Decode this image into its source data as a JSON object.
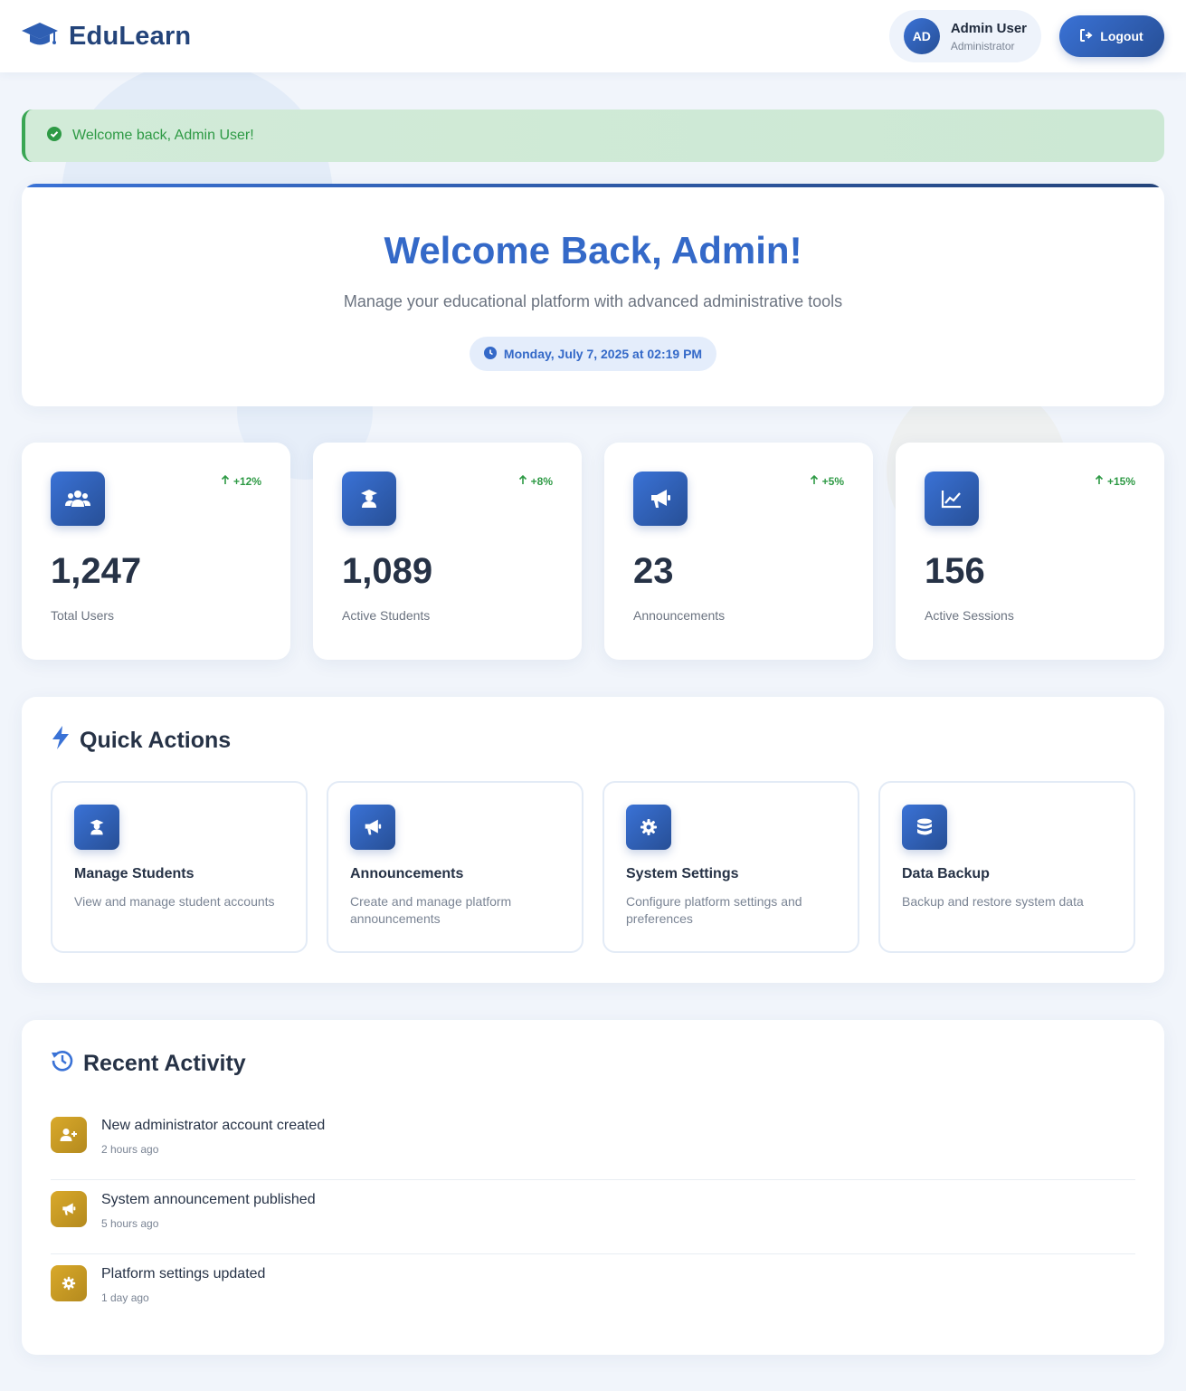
{
  "header": {
    "brand": "EduLearn",
    "user_initials": "AD",
    "user_name": "Admin User",
    "user_role": "Administrator",
    "logout_label": "Logout"
  },
  "alert": {
    "message": "Welcome back, Admin User!"
  },
  "hero": {
    "title": "Welcome Back, Admin!",
    "subtitle": "Manage your educational platform with advanced administrative tools",
    "datetime": "Monday, July 7, 2025 at 02:19 PM"
  },
  "stats": [
    {
      "icon": "users-icon",
      "trend": "+12%",
      "value": "1,247",
      "label": "Total Users"
    },
    {
      "icon": "graduate-icon",
      "trend": "+8%",
      "value": "1,089",
      "label": "Active Students"
    },
    {
      "icon": "megaphone-icon",
      "trend": "+5%",
      "value": "23",
      "label": "Announcements"
    },
    {
      "icon": "chart-line-icon",
      "trend": "+15%",
      "value": "156",
      "label": "Active Sessions"
    }
  ],
  "quick_actions": {
    "title": "Quick Actions",
    "items": [
      {
        "icon": "graduate-icon",
        "title": "Manage Students",
        "desc": "View and manage student accounts"
      },
      {
        "icon": "megaphone-icon",
        "title": "Announcements",
        "desc": "Create and manage platform announcements"
      },
      {
        "icon": "gear-icon",
        "title": "System Settings",
        "desc": "Configure platform settings and preferences"
      },
      {
        "icon": "database-icon",
        "title": "Data Backup",
        "desc": "Backup and restore system data"
      }
    ]
  },
  "recent_activity": {
    "title": "Recent Activity",
    "items": [
      {
        "icon": "user-plus-icon",
        "title": "New administrator account created",
        "time": "2 hours ago"
      },
      {
        "icon": "megaphone-icon",
        "title": "System announcement published",
        "time": "5 hours ago"
      },
      {
        "icon": "gear-icon",
        "title": "Platform settings updated",
        "time": "1 day ago"
      }
    ]
  },
  "colors": {
    "primary": "#3469c8",
    "primary_dark": "#24447a",
    "success": "#2e9a45",
    "activity_gold": "#c99a22",
    "background": "#f1f5fb"
  }
}
